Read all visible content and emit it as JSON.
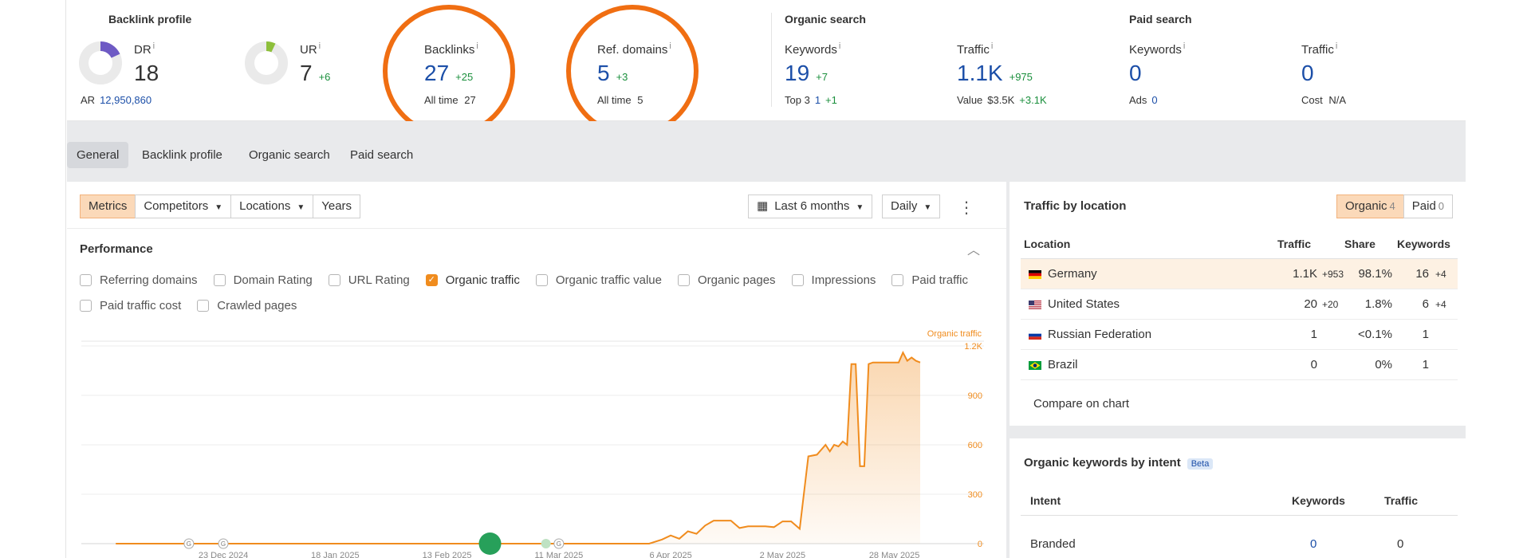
{
  "header": {
    "backlink_profile": {
      "title": "Backlink profile",
      "dr": {
        "label": "DR",
        "value": "18",
        "gauge": 0.18,
        "color": "#6e5ac4"
      },
      "ar": {
        "label": "AR",
        "value": "12,950,860"
      },
      "ur": {
        "label": "UR",
        "value": "7",
        "delta": "+6",
        "gauge": 0.07,
        "color": "#8dbf3a"
      },
      "backlinks": {
        "label": "Backlinks",
        "value": "27",
        "delta": "+25",
        "sub_label": "All time",
        "sub_value": "27"
      },
      "ref_domains": {
        "label": "Ref. domains",
        "value": "5",
        "delta": "+3",
        "sub_label": "All time",
        "sub_value": "5"
      }
    },
    "organic_search": {
      "title": "Organic search",
      "keywords": {
        "label": "Keywords",
        "value": "19",
        "delta": "+7",
        "sub_label": "Top 3",
        "sub_value": "1",
        "sub_delta": "+1"
      },
      "traffic": {
        "label": "Traffic",
        "value": "1.1K",
        "delta": "+975",
        "sub_label": "Value",
        "sub_value": "$3.5K",
        "sub_delta": "+3.1K"
      }
    },
    "paid_search": {
      "title": "Paid search",
      "keywords": {
        "label": "Keywords",
        "value": "0",
        "sub_label": "Ads",
        "sub_value": "0"
      },
      "traffic": {
        "label": "Traffic",
        "value": "0",
        "sub_label": "Cost",
        "sub_value": "N/A"
      }
    },
    "info_glyph": "i"
  },
  "tabs": [
    "General",
    "Backlink profile",
    "Organic search",
    "Paid search"
  ],
  "toolbar": {
    "buttons": [
      "Metrics",
      "Competitors",
      "Locations",
      "Years"
    ],
    "date_range": "Last 6 months",
    "interval": "Daily",
    "more_glyph": "⋮"
  },
  "performance": {
    "title": "Performance",
    "checkboxes": [
      {
        "label": "Referring domains",
        "checked": false
      },
      {
        "label": "Domain Rating",
        "checked": false
      },
      {
        "label": "URL Rating",
        "checked": false
      },
      {
        "label": "Organic traffic",
        "checked": true
      },
      {
        "label": "Organic traffic value",
        "checked": false
      },
      {
        "label": "Organic pages",
        "checked": false
      },
      {
        "label": "Impressions",
        "checked": false
      },
      {
        "label": "Paid traffic",
        "checked": false
      },
      {
        "label": "Paid traffic cost",
        "checked": false
      },
      {
        "label": "Crawled pages",
        "checked": false
      }
    ]
  },
  "chart_data": {
    "type": "area",
    "series": [
      {
        "name": "Organic traffic",
        "color": "#f08c1e",
        "x": [
          "2024-11-28",
          "2024-12-10",
          "2024-12-23",
          "2025-01-05",
          "2025-01-18",
          "2025-01-31",
          "2025-02-13",
          "2025-02-26",
          "2025-03-11",
          "2025-03-24",
          "2025-04-01",
          "2025-04-04",
          "2025-04-06",
          "2025-04-08",
          "2025-04-10",
          "2025-04-12",
          "2025-04-14",
          "2025-04-16",
          "2025-04-18",
          "2025-04-20",
          "2025-04-22",
          "2025-04-24",
          "2025-04-26",
          "2025-04-28",
          "2025-04-30",
          "2025-05-02",
          "2025-05-04",
          "2025-05-06",
          "2025-05-08",
          "2025-05-10",
          "2025-05-12",
          "2025-05-13",
          "2025-05-14",
          "2025-05-15",
          "2025-05-16",
          "2025-05-17",
          "2025-05-18",
          "2025-05-19",
          "2025-05-20",
          "2025-05-21",
          "2025-05-22",
          "2025-05-23",
          "2025-05-24",
          "2025-05-25",
          "2025-05-26",
          "2025-05-27",
          "2025-05-28",
          "2025-05-29",
          "2025-05-30",
          "2025-05-31",
          "2025-06-01",
          "2025-06-02",
          "2025-06-03"
        ],
        "values": [
          0,
          0,
          0,
          0,
          0,
          0,
          0,
          0,
          0,
          0,
          0,
          25,
          50,
          30,
          75,
          60,
          110,
          140,
          140,
          140,
          95,
          105,
          105,
          105,
          100,
          135,
          135,
          90,
          530,
          540,
          600,
          560,
          600,
          590,
          620,
          600,
          1090,
          1090,
          470,
          470,
          1090,
          1100,
          1100,
          1100,
          1100,
          1100,
          1100,
          1100,
          1160,
          1110,
          1130,
          1110,
          1100
        ]
      }
    ],
    "x_tick_labels": [
      "23 Dec 2024",
      "18 Jan 2025",
      "13 Feb 2025",
      "11 Mar 2025",
      "6 Apr 2025",
      "2 May 2025",
      "28 May 2025"
    ],
    "y_ticks": [
      0,
      300,
      600,
      900,
      1200
    ],
    "y_tick_labels": [
      "0",
      "300",
      "600",
      "900",
      "1.2K"
    ],
    "ylim": [
      0,
      1200
    ],
    "legend": "top-right",
    "grid": true
  },
  "annotations": {
    "google_markers": [
      "G",
      "G",
      "G"
    ]
  },
  "traffic_by_location": {
    "title": "Traffic by location",
    "toggle": [
      {
        "label": "Organic",
        "count": "4",
        "active": true
      },
      {
        "label": "Paid",
        "count": "0",
        "active": false
      }
    ],
    "columns": [
      "Location",
      "Traffic",
      "Share",
      "Keywords"
    ],
    "rows": [
      {
        "country": "Germany",
        "flag": "de",
        "traffic": "1.1K",
        "traffic_delta": "+953",
        "share": "98.1%",
        "keywords": "16",
        "keywords_delta": "+4"
      },
      {
        "country": "United States",
        "flag": "us",
        "traffic": "20",
        "traffic_delta": "+20",
        "share": "1.8%",
        "keywords": "6",
        "keywords_delta": "+4"
      },
      {
        "country": "Russian Federation",
        "flag": "ru",
        "traffic": "1",
        "traffic_delta": "",
        "share": "<0.1%",
        "keywords": "1",
        "keywords_delta": ""
      },
      {
        "country": "Brazil",
        "flag": "br",
        "traffic": "0",
        "traffic_delta": "",
        "share": "0%",
        "keywords": "1",
        "keywords_delta": ""
      }
    ],
    "compare_label": "Compare on chart"
  },
  "intent": {
    "title": "Organic keywords by intent",
    "badge": "Beta",
    "columns": [
      "Intent",
      "Keywords",
      "Traffic"
    ],
    "rows": [
      {
        "intent": "Branded",
        "keywords": "0",
        "traffic": "0"
      }
    ]
  },
  "colors": {
    "highlight_circle": "#f06e12",
    "accent_orange": "#f08c1e",
    "link_blue": "#1c4fa8",
    "delta_green": "#1a8f3c"
  }
}
